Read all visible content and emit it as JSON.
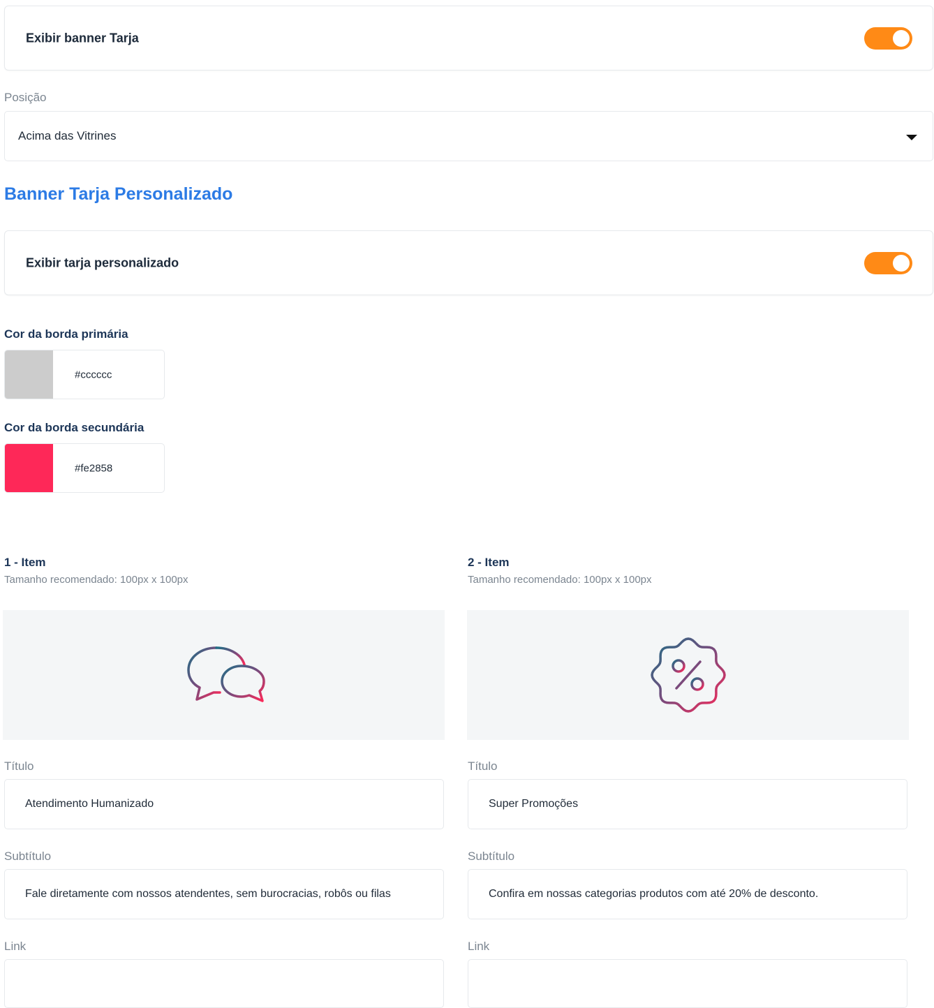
{
  "banner_toggle": {
    "label": "Exibir banner Tarja",
    "enabled": true
  },
  "position": {
    "label": "Posição",
    "value": "Acima das Vitrines"
  },
  "section": {
    "title": "Banner Tarja Personalizado"
  },
  "custom_toggle": {
    "label": "Exibir tarja personalizado",
    "enabled": true
  },
  "colors": {
    "primary": {
      "label": "Cor da borda primária",
      "value": "#cccccc"
    },
    "secondary": {
      "label": "Cor da borda secundária",
      "value": "#fe2858"
    }
  },
  "accent_colors": {
    "toggle": "#ff8a16",
    "heading": "#2c7be5"
  },
  "items": [
    {
      "title": "1 - Item",
      "hint": "Tamanho recomendado: 100px x 100px",
      "icon": "chat-bubbles-icon",
      "titulo_label": "Título",
      "titulo_value": "Atendimento Humanizado",
      "subtitulo_label": "Subtítulo",
      "subtitulo_value": "Fale diretamente com nossos atendentes, sem burocracias, robôs ou filas",
      "link_label": "Link",
      "link_value": ""
    },
    {
      "title": "2 - Item",
      "hint": "Tamanho recomendado: 100px x 100px",
      "icon": "discount-badge-icon",
      "titulo_label": "Título",
      "titulo_value": "Super Promoções",
      "subtitulo_label": "Subtítulo",
      "subtitulo_value": "Confira em nossas categorias produtos com até 20% de desconto.",
      "link_label": "Link",
      "link_value": ""
    }
  ]
}
